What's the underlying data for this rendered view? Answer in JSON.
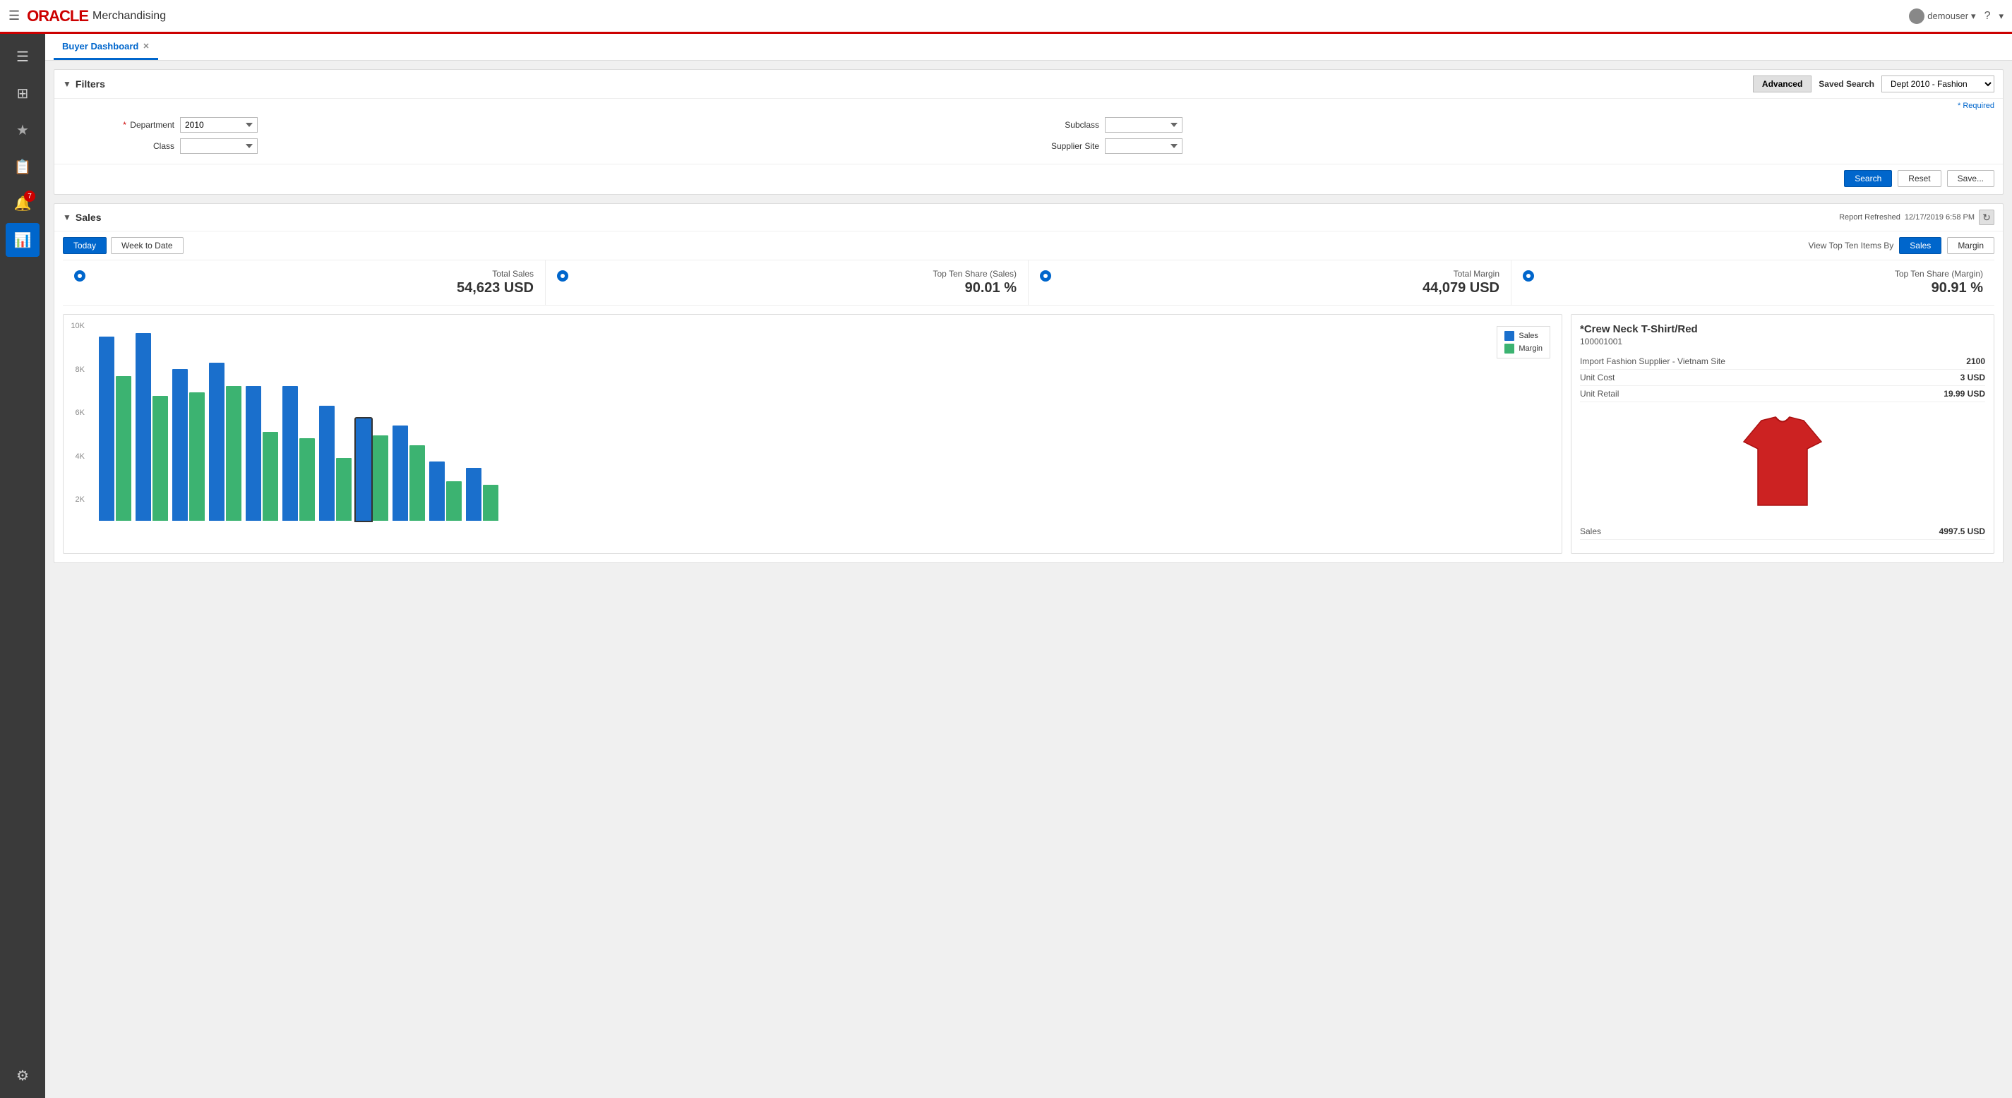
{
  "app": {
    "title": "Merchandising",
    "oracle_label": "ORACLE"
  },
  "nav": {
    "user": "demouser"
  },
  "sidebar": {
    "items": [
      {
        "id": "menu",
        "icon": "☰",
        "active": false
      },
      {
        "id": "grid",
        "icon": "⊞",
        "active": false
      },
      {
        "id": "star",
        "icon": "★",
        "active": false
      },
      {
        "id": "clipboard",
        "icon": "📋",
        "active": false
      },
      {
        "id": "bell",
        "icon": "🔔",
        "active": false,
        "badge": "7"
      },
      {
        "id": "chart",
        "icon": "📊",
        "active": true
      },
      {
        "id": "gear",
        "icon": "⚙",
        "active": false
      }
    ]
  },
  "tabs": [
    {
      "label": "Buyer Dashboard",
      "active": true,
      "closable": true
    }
  ],
  "filters": {
    "title": "Filters",
    "advanced_label": "Advanced",
    "saved_search_label": "Saved Search",
    "saved_search_value": "Dept 2010 - Fashion",
    "required_note": "* Required",
    "department_label": "Department",
    "department_value": "2010",
    "class_label": "Class",
    "class_value": "",
    "subclass_label": "Subclass",
    "subclass_value": "",
    "supplier_site_label": "Supplier Site",
    "supplier_site_value": "",
    "search_label": "Search",
    "reset_label": "Reset",
    "save_label": "Save..."
  },
  "sales": {
    "title": "Sales",
    "report_refreshed_label": "Report Refreshed",
    "report_refreshed_date": "12/17/2019 6:58 PM",
    "today_label": "Today",
    "week_to_date_label": "Week to Date",
    "view_top_ten_label": "View Top Ten Items By",
    "sales_btn_label": "Sales",
    "margin_btn_label": "Margin",
    "kpis": [
      {
        "label": "Total Sales",
        "value": "54,623 USD"
      },
      {
        "label": "Top Ten Share (Sales)",
        "value": "90.01 %"
      },
      {
        "label": "Total Margin",
        "value": "44,079 USD"
      },
      {
        "label": "Top Ten Share (Margin)",
        "value": "90.91 %"
      }
    ],
    "chart": {
      "y_labels": [
        "10K",
        "8K",
        "6K",
        "4K",
        "2K"
      ],
      "legend": [
        {
          "label": "Sales",
          "color": "#1a6fcc"
        },
        {
          "label": "Margin",
          "color": "#3cb371"
        }
      ],
      "bars": [
        {
          "sales": 280,
          "margin": 220
        },
        {
          "sales": 285,
          "margin": 190
        },
        {
          "sales": 230,
          "margin": 195
        },
        {
          "sales": 240,
          "margin": 205
        },
        {
          "sales": 205,
          "margin": 135
        },
        {
          "sales": 205,
          "margin": 125
        },
        {
          "sales": 175,
          "margin": 95
        },
        {
          "sales": 155,
          "margin": 130
        },
        {
          "sales": 145,
          "margin": 115
        },
        {
          "sales": 90,
          "margin": 60
        },
        {
          "sales": 80,
          "margin": 55
        }
      ]
    },
    "detail": {
      "item_name": "*Crew Neck T-Shirt/Red",
      "item_code": "100001001",
      "supplier": "Import Fashion Supplier - Vietnam Site",
      "supplier_value": "2100",
      "unit_cost_label": "Unit Cost",
      "unit_cost_value": "3 USD",
      "unit_retail_label": "Unit Retail",
      "unit_retail_value": "19.99 USD",
      "sales_label": "Sales",
      "sales_value": "4997.5 USD"
    }
  }
}
